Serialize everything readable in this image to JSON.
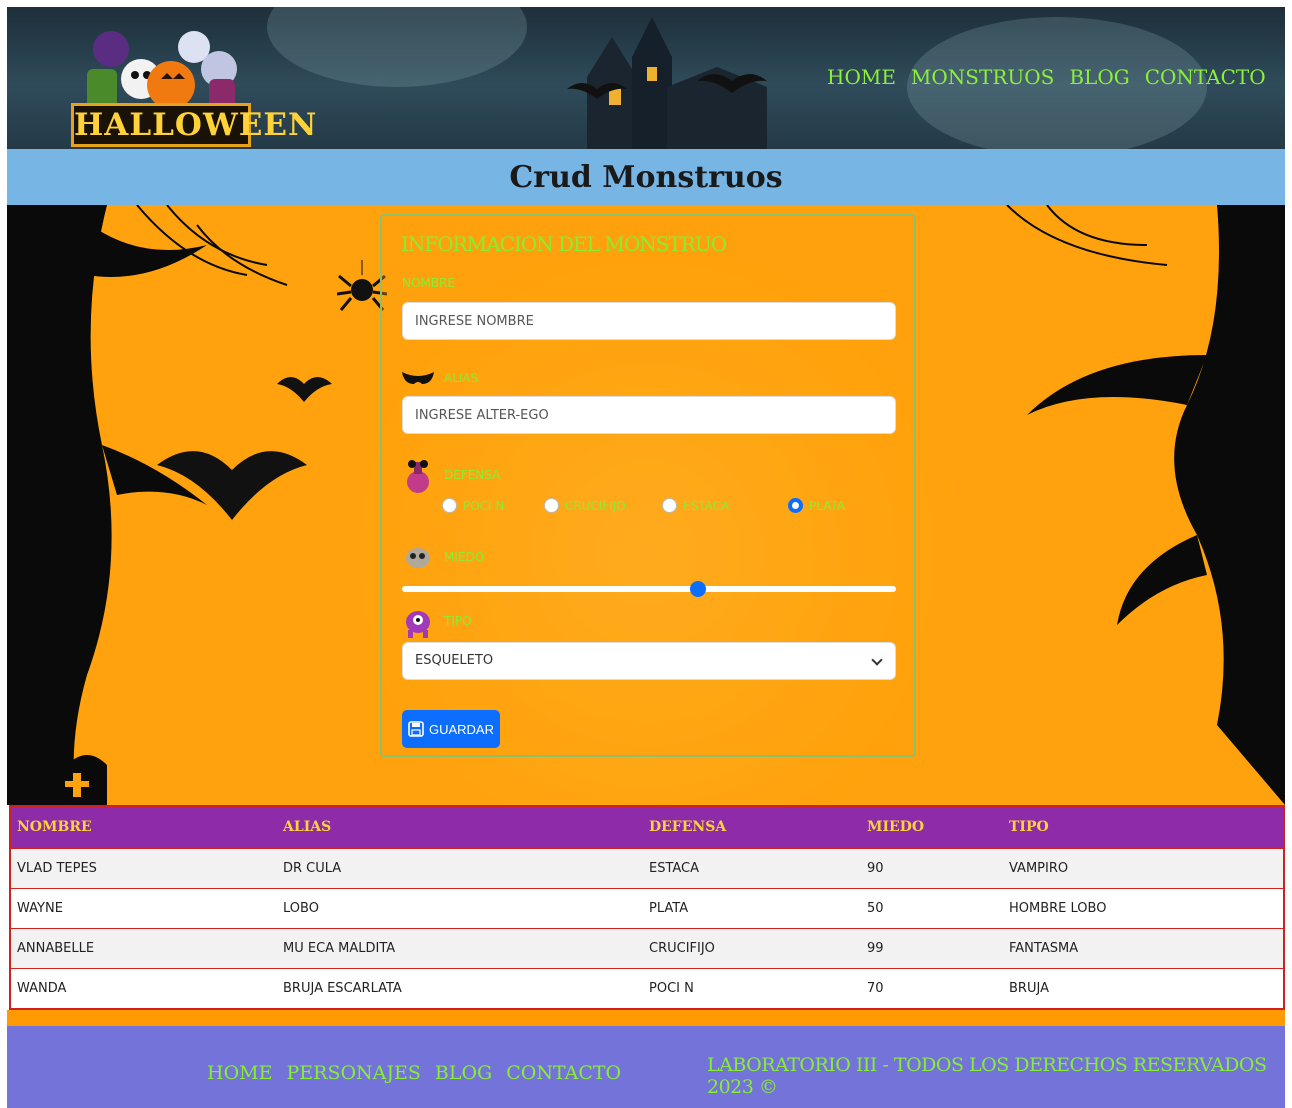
{
  "header": {
    "logo_text": "HALLOWEEN",
    "nav": [
      "HOME",
      "MONSTRUOS",
      "BLOG",
      "CONTACTO"
    ]
  },
  "page_title": "Crud Monstruos",
  "form": {
    "legend": "INFORMACION DEL MONSTRUO",
    "nombre_label": "NOMBRE",
    "nombre_placeholder": "INGRESE NOMBRE",
    "alias_label": "ALIAS",
    "alias_placeholder": "INGRESE ALTER-EGO",
    "defensa_label": "DEFENSA",
    "defensa_options": [
      "POCI N",
      "CRUCIFIJO",
      "ESTACA",
      "PLATA"
    ],
    "defensa_selected": "PLATA",
    "miedo_label": "MIEDO",
    "miedo_value_fraction": 0.6,
    "tipo_label": "TIPO",
    "tipo_selected": "ESQUELETO",
    "save_label": "GUARDAR"
  },
  "table": {
    "headers": [
      "NOMBRE",
      "ALIAS",
      "DEFENSA",
      "MIEDO",
      "TIPO"
    ],
    "rows": [
      [
        "VLAD TEPES",
        "DR CULA",
        "ESTACA",
        "90",
        "VAMPIRO"
      ],
      [
        "WAYNE",
        "LOBO",
        "PLATA",
        "50",
        "HOMBRE LOBO"
      ],
      [
        "ANNABELLE",
        "MU ECA MALDITA",
        "CRUCIFIJO",
        "99",
        "FANTASMA"
      ],
      [
        "WANDA",
        "BRUJA ESCARLATA",
        "POCI N",
        "70",
        "BRUJA"
      ]
    ]
  },
  "footer": {
    "nav": [
      "HOME",
      "PERSONAJES",
      "BLOG",
      "CONTACTO"
    ],
    "copyright": "LABORATORIO III - TODOS LOS DERECHOS RESERVADOS 2023 ©"
  },
  "colors": {
    "accent_green": "#88ee33",
    "title_bar": "#77b5e4",
    "hero_orange": "#ffa20e",
    "table_header": "#8e2ba8",
    "footer_bg": "#7373d9",
    "primary_button": "#0d6efd"
  }
}
